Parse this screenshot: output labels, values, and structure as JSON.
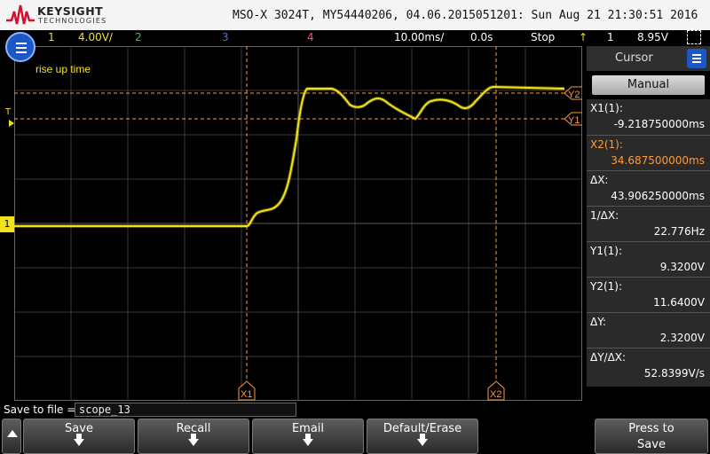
{
  "header": {
    "brand": "KEYSIGHT",
    "brand_sub": "TECHNOLOGIES",
    "title": "MSO-X 3024T, MY54440206, 04.06.2015051201: Sun Aug 21 21:30:51 2016"
  },
  "status": {
    "ch1_num": "1",
    "ch1_scale": "4.00V/",
    "ch2_num": "2",
    "ch3_num": "3",
    "ch4_num": "4",
    "timebase": "10.00ms/",
    "delay": "0.0s",
    "run_state": "Stop",
    "trig_src": "1",
    "trig_level": "8.95V"
  },
  "colors": {
    "ch1": "#f2e21a",
    "ch2": "#2fd12f",
    "ch3": "#4a6cff",
    "ch4": "#ff4d88",
    "cursor": "#ff9a3c",
    "accent": "#1c57c5"
  },
  "screen": {
    "annotation": "rise up time",
    "trigger_marker": "T",
    "ground_marker": "1",
    "cursor_labels": {
      "x1": "X1",
      "x2": "X2",
      "y1": "Y1",
      "y2": "Y2"
    }
  },
  "cursor_panel": {
    "title": "Cursor",
    "mode": "Manual",
    "rows": [
      {
        "key": "X1(1):",
        "value": "-9.218750000ms"
      },
      {
        "key": "X2(1):",
        "value": "34.687500000ms"
      },
      {
        "key": "ΔX:",
        "value": "43.906250000ms"
      },
      {
        "key": "1/ΔX:",
        "value": "22.776Hz"
      },
      {
        "key": "Y1(1):",
        "value": "9.3200V"
      },
      {
        "key": "Y2(1):",
        "value": "11.6400V"
      },
      {
        "key": "ΔY:",
        "value": "2.3200V"
      },
      {
        "key": "ΔY/ΔX:",
        "value": "52.8399V/s"
      }
    ]
  },
  "save": {
    "label": "Save to file =",
    "filename": "scope_13"
  },
  "softkeys": {
    "save": "Save",
    "recall": "Recall",
    "email": "Email",
    "default_erase": "Default/Erase",
    "press_to_save_1": "Press to",
    "press_to_save_2": "Save"
  }
}
